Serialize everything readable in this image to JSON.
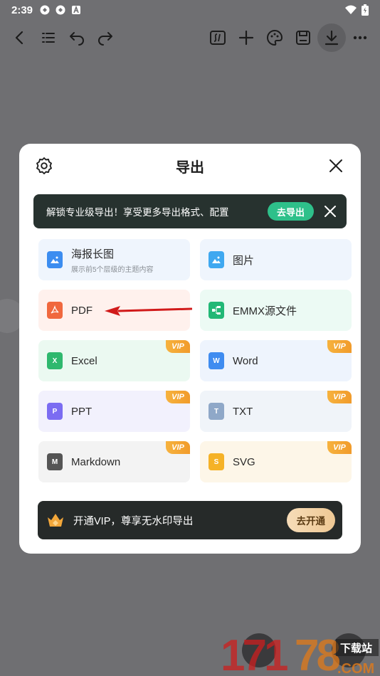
{
  "status_bar": {
    "time": "2:39",
    "left_icons": [
      "notification-icon",
      "notification-icon",
      "a-icon"
    ],
    "right_icons": [
      "wifi-icon",
      "battery-icon"
    ]
  },
  "toolbar": {
    "items": [
      "back-icon",
      "outline-icon",
      "undo-icon",
      "redo-icon",
      "formula-icon",
      "add-icon",
      "palette-icon",
      "save-icon",
      "download-icon",
      "more-icon"
    ],
    "active": "download-icon"
  },
  "dialog": {
    "title": "导出",
    "promo": {
      "text": "解锁专业级导出！享受更多导出格式、配置",
      "button": "去导出"
    },
    "formats": [
      {
        "label": "海报长图",
        "sub": "展示前5个层级的主题内容",
        "icon": "poster-icon",
        "vip": false
      },
      {
        "label": "图片",
        "sub": "",
        "icon": "image-icon",
        "vip": false
      },
      {
        "label": "PDF",
        "sub": "",
        "icon": "pdf-icon",
        "vip": false
      },
      {
        "label": "EMMX源文件",
        "sub": "",
        "icon": "emmx-icon",
        "vip": false
      },
      {
        "label": "Excel",
        "sub": "",
        "icon": "excel-icon",
        "icon_text": "X",
        "vip": true
      },
      {
        "label": "Word",
        "sub": "",
        "icon": "word-icon",
        "icon_text": "W",
        "vip": true
      },
      {
        "label": "PPT",
        "sub": "",
        "icon": "ppt-icon",
        "icon_text": "P",
        "vip": true
      },
      {
        "label": "TXT",
        "sub": "",
        "icon": "txt-icon",
        "icon_text": "T",
        "vip": true
      },
      {
        "label": "Markdown",
        "sub": "",
        "icon": "markdown-icon",
        "icon_text": "M",
        "vip": true
      },
      {
        "label": "SVG",
        "sub": "",
        "icon": "svg-icon",
        "icon_text": "S",
        "vip": true
      }
    ],
    "vip_badge": "VIP",
    "vip_bar": {
      "text": "开通VIP，尊享无水印导出",
      "button": "去开通"
    }
  },
  "watermark": {
    "text": "17178.COM",
    "tag": "下载站"
  },
  "colors": {
    "promo_bg": "#27322f",
    "promo_button": "#2ec08a",
    "vip_badge": "#f19b2b",
    "pdf_icon": "#f0683e",
    "excel_icon": "#2fb86e",
    "word_icon": "#3f8cf0",
    "ppt_icon": "#7b6cf2",
    "txt_icon": "#8fa8c8",
    "markdown_icon": "#555555",
    "svg_icon": "#f5b227",
    "arrow": "#e01b1b"
  }
}
